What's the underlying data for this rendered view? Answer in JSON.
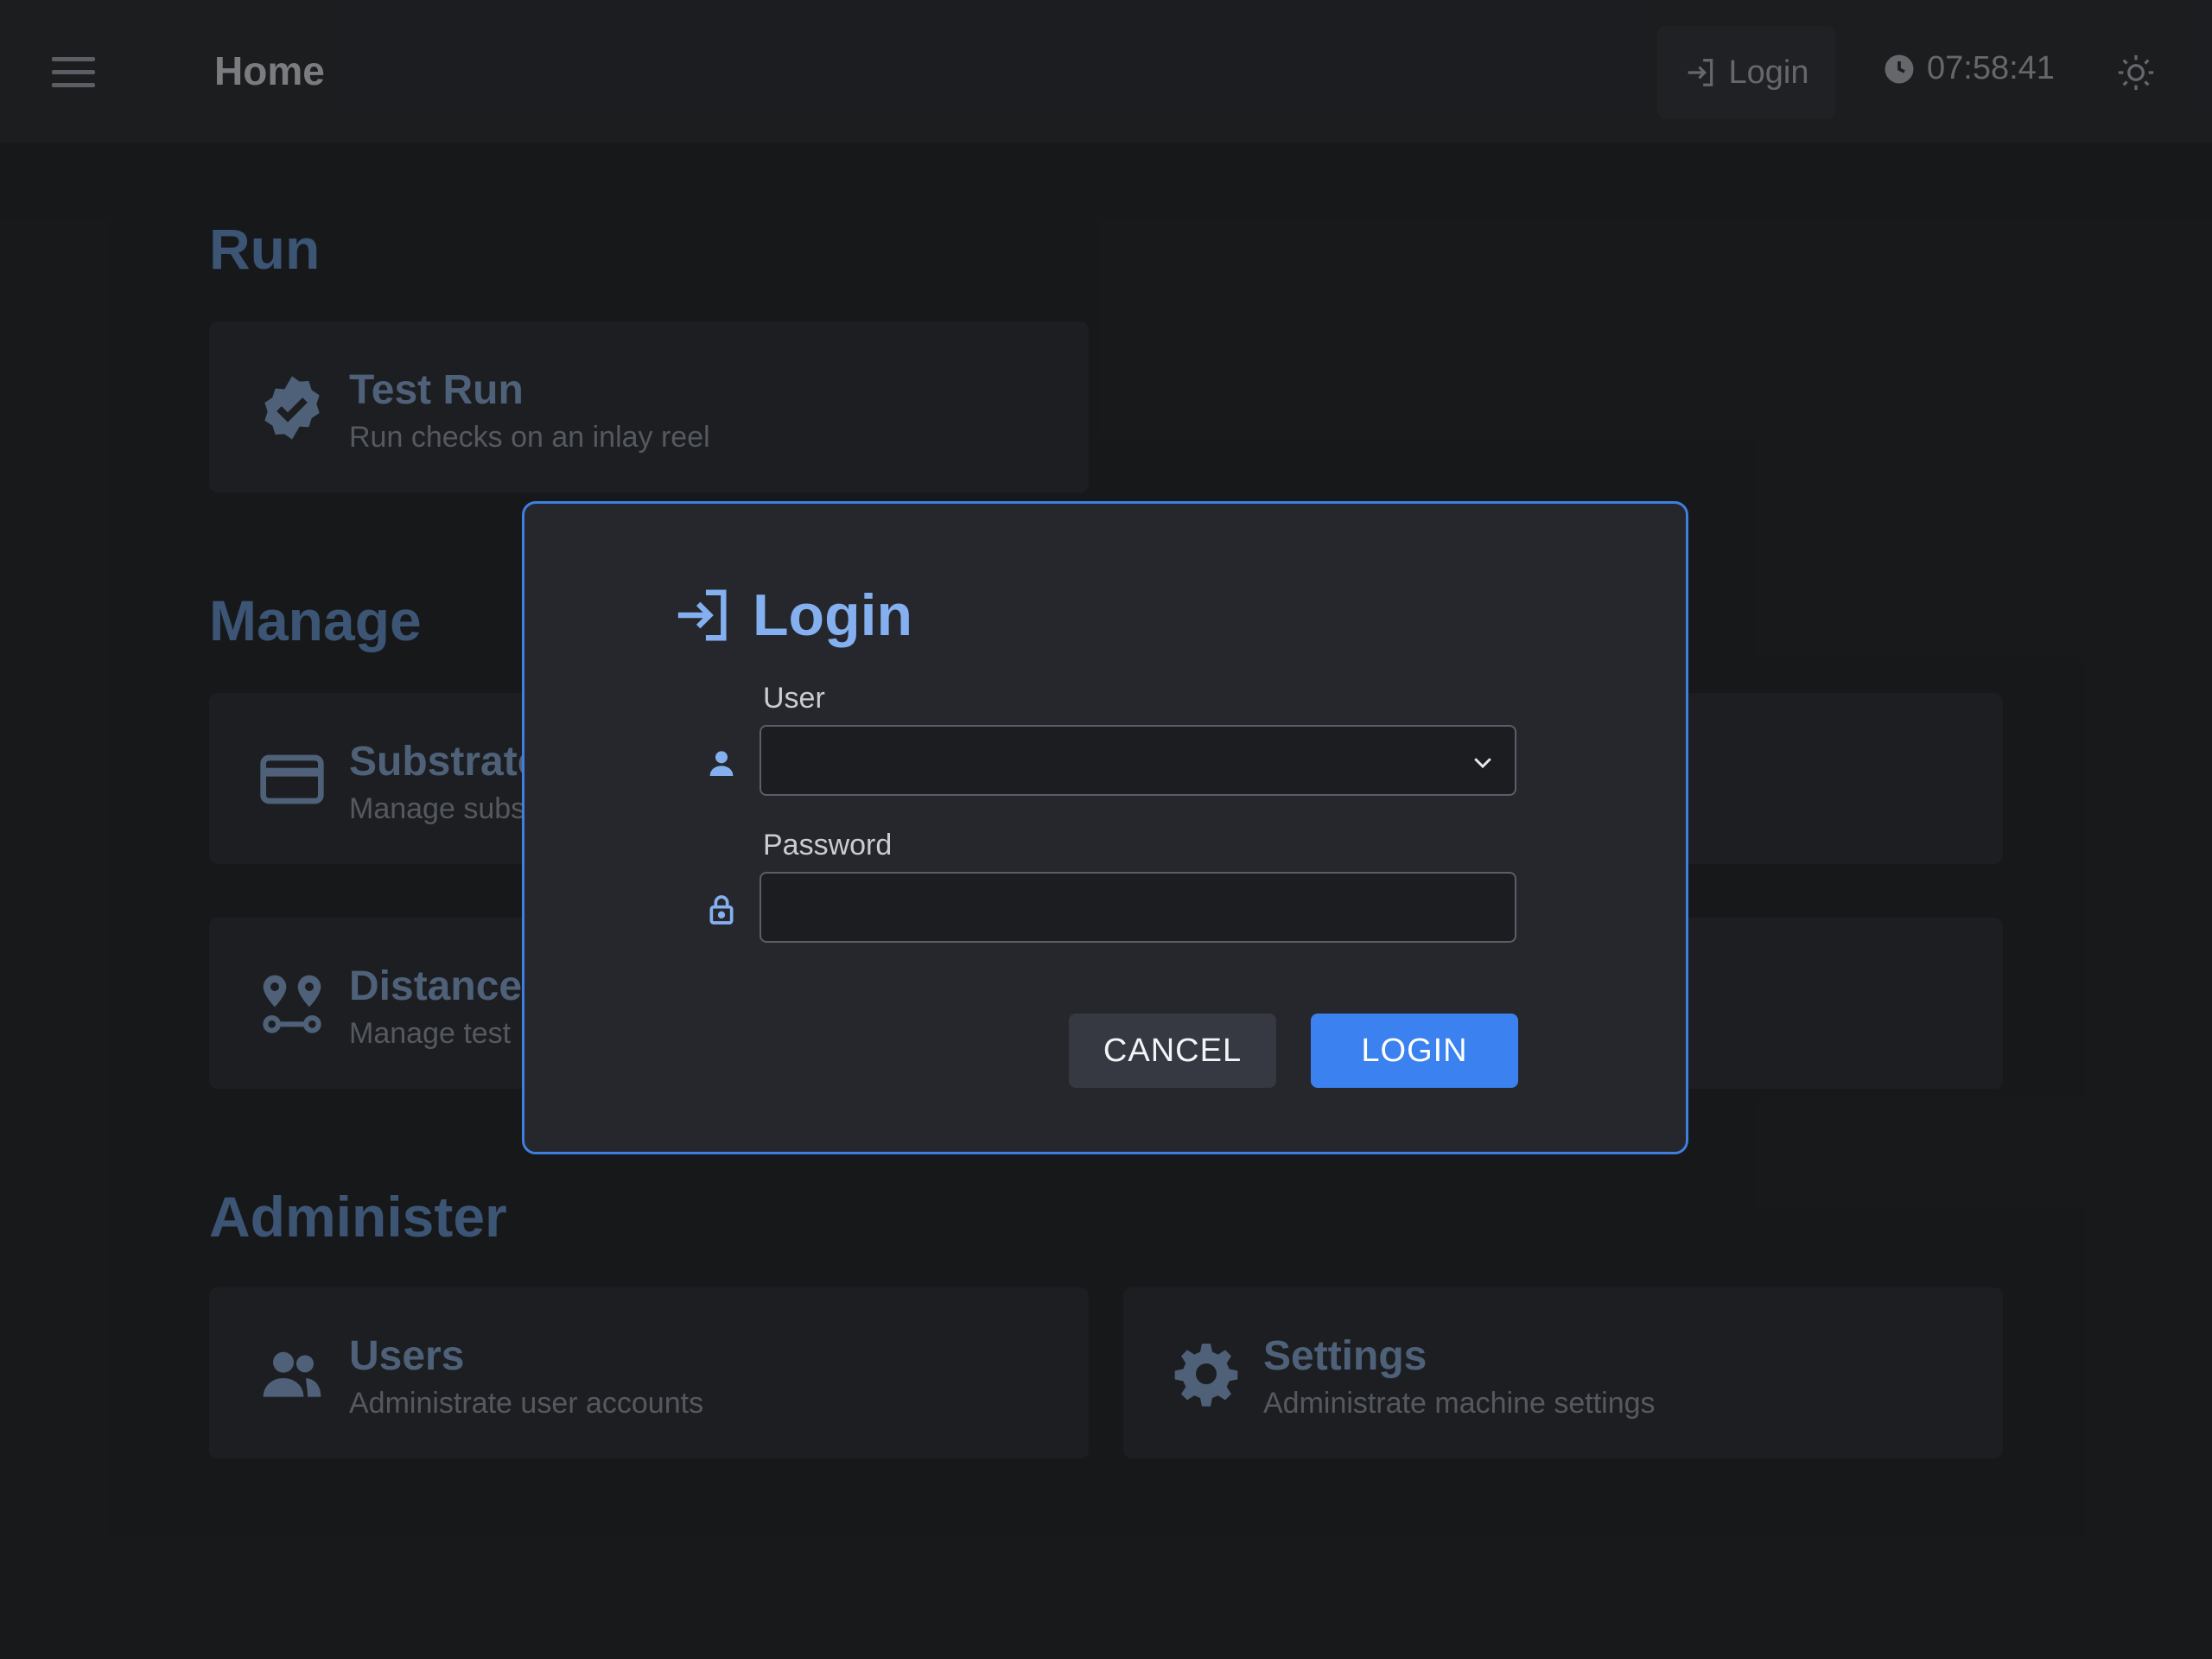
{
  "header": {
    "title": "Home",
    "login_label": "Login",
    "time": "07:58:41"
  },
  "sections": {
    "run": {
      "title": "Run"
    },
    "manage": {
      "title": "Manage"
    },
    "administer": {
      "title": "Administer"
    }
  },
  "cards": {
    "test_run": {
      "title": "Test Run",
      "subtitle": "Run checks on an inlay reel"
    },
    "substrate": {
      "title": "Substrate",
      "subtitle": "Manage subs"
    },
    "distances": {
      "title": "Distances",
      "subtitle": "Manage test"
    },
    "users": {
      "title": "Users",
      "subtitle": "Administrate user accounts"
    },
    "settings": {
      "title": "Settings",
      "subtitle": "Administrate machine settings"
    }
  },
  "dialog": {
    "title": "Login",
    "user_label": "User",
    "user_value": "",
    "password_label": "Password",
    "password_value": "",
    "cancel_label": "CANCEL",
    "login_label": "LOGIN"
  },
  "colors": {
    "accent": "#3b82f0",
    "dialog_border": "#3f7fe0",
    "section_title": "#6e9bd6"
  }
}
